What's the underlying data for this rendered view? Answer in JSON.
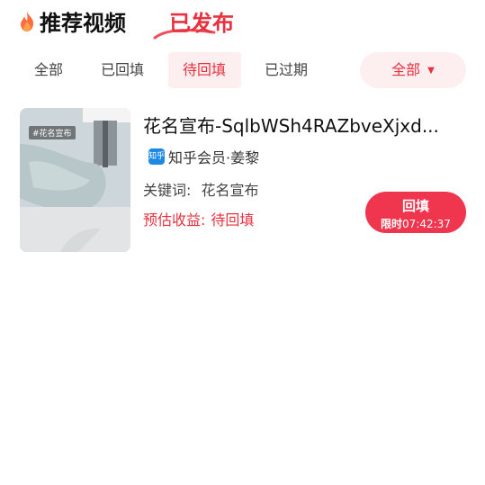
{
  "header": {
    "tab_recommend": "推荐视频",
    "tab_published": "已发布",
    "accent_color": "#e8313f"
  },
  "filters": {
    "items": [
      {
        "label": "全部",
        "active": false
      },
      {
        "label": "已回填",
        "active": false
      },
      {
        "label": "待回填",
        "active": true
      },
      {
        "label": "已过期",
        "active": false
      }
    ],
    "dropdown": {
      "selected": "全部",
      "icon": "caret-down-icon"
    }
  },
  "card": {
    "thumb_tag": "#花名宣布",
    "title": "花名宣布-SqlbWSh4RAZbveXjxd...",
    "author_platform_icon": "知乎",
    "author": "知乎会员·姜黎",
    "keyword_label": "关键词:",
    "keyword_value": "花名宣布",
    "earnings_label": "预估收益:",
    "earnings_value": "待回填",
    "button_label": "回填",
    "limit_label": "限时",
    "limit_time": "07:42:37"
  }
}
